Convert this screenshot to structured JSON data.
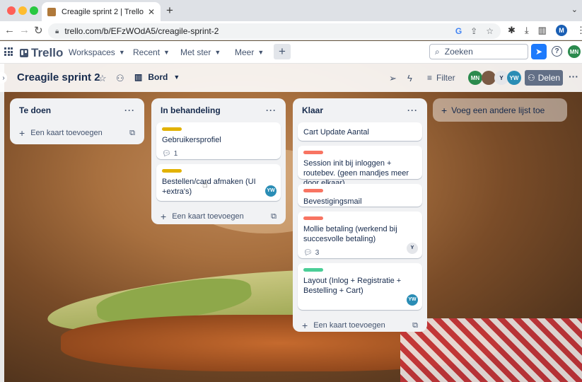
{
  "browser": {
    "tab_title": "Creagile sprint 2 | Trello",
    "url": "trello.com/b/EFzWOdA5/creagile-sprint-2",
    "profile_initial": "M"
  },
  "header": {
    "logo_text": "Trello",
    "menus": [
      "Workspaces",
      "Recent",
      "Met ster",
      "Meer"
    ],
    "search_placeholder": "Zoeken",
    "user_initials": "MN"
  },
  "board": {
    "title": "Creagile sprint 2",
    "view": "Bord",
    "filter_label": "Filter",
    "share_label": "Delen",
    "members": [
      "MN",
      "",
      "Y",
      "YW"
    ],
    "add_list_label": "Voeg een andere lijst toe"
  },
  "colors": {
    "yellow": "#e2b203",
    "red": "#f87462",
    "green": "#4bce97",
    "avatar_yw": "#2a8db5"
  },
  "lists": [
    {
      "title": "Te doen",
      "add_card": "Een kaart toevoegen",
      "cards": []
    },
    {
      "title": "In behandeling",
      "add_card": "Een kaart toevoegen",
      "cards": [
        {
          "label": "yellow",
          "title": "Gebruikersprofiel",
          "comments": "1",
          "avatar": ""
        },
        {
          "label": "yellow",
          "title": "Bestellen/card afmaken (UI +extra's)",
          "comments": "",
          "avatar": "YW"
        }
      ]
    },
    {
      "title": "Klaar",
      "add_card": "Een kaart toevoegen",
      "cards": [
        {
          "label": "",
          "title": "Cart Update Aantal",
          "comments": "",
          "avatar": ""
        },
        {
          "label": "red",
          "title": "Session init bij inloggen + routebev. (geen mandjes meer door elkaar)",
          "comments": "",
          "avatar": ""
        },
        {
          "label": "red",
          "title": "Bevestigingsmail",
          "comments": "",
          "avatar": ""
        },
        {
          "label": "red",
          "title": "Mollie betaling (werkend bij succesvolle betaling)",
          "comments": "3",
          "avatar": "Y"
        },
        {
          "label": "green",
          "title": "Layout (Inlog + Registratie + Bestelling + Cart)",
          "comments": "",
          "avatar": "YW"
        }
      ]
    }
  ]
}
